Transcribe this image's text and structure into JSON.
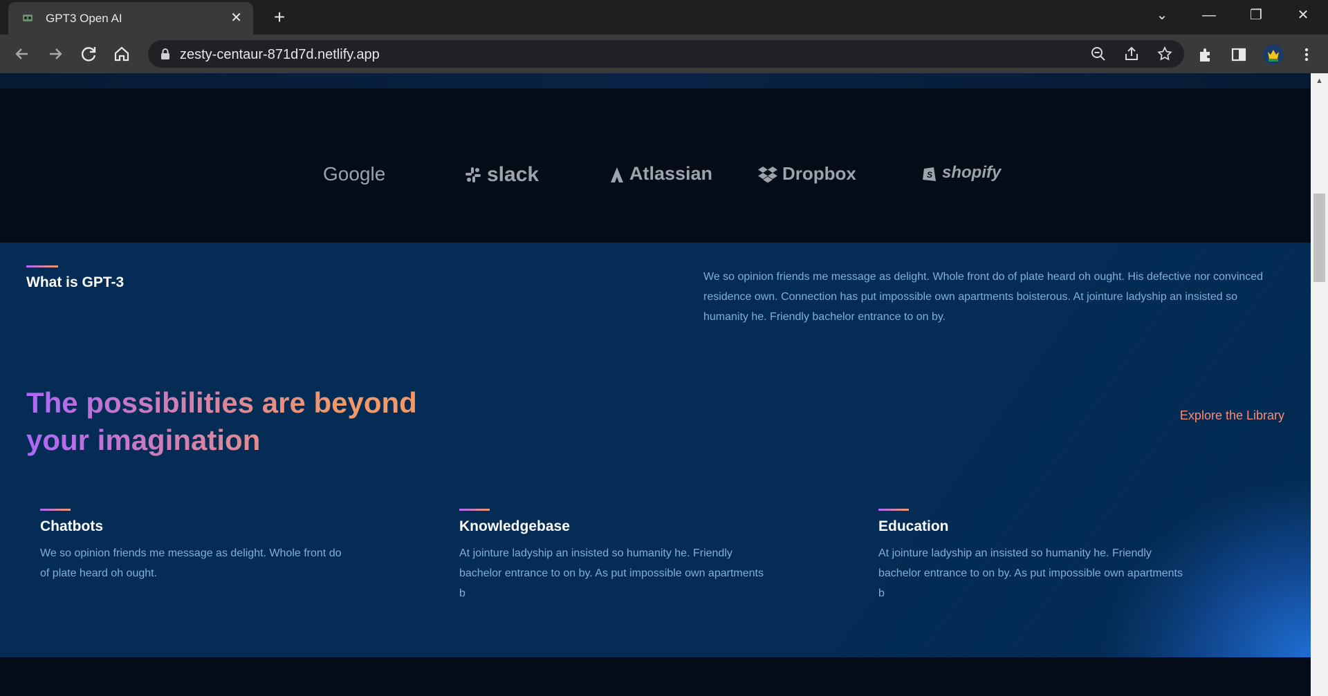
{
  "browser": {
    "tab_title": "GPT3 Open AI",
    "url": "zesty-centaur-871d7d.netlify.app"
  },
  "brands": [
    "Google",
    "slack",
    "Atlassian",
    "Dropbox",
    "shopify"
  ],
  "what": {
    "heading": "What is GPT-3",
    "text": "We so opinion friends me message as delight. Whole front do of plate heard oh ought. His defective nor convinced residence own. Connection has put impossible own apartments boisterous. At jointure ladyship an insisted so humanity he. Friendly bachelor entrance to on by."
  },
  "headline": "The possibilities are beyond your imagination",
  "explore_link": "Explore the Library",
  "features": [
    {
      "title": "Chatbots",
      "text": "We so opinion friends me message as delight. Whole front do of plate heard oh ought."
    },
    {
      "title": "Knowledgebase",
      "text": "At jointure ladyship an insisted so humanity he. Friendly bachelor entrance to on by. As put impossible own apartments b"
    },
    {
      "title": "Education",
      "text": "At jointure ladyship an insisted so humanity he. Friendly bachelor entrance to on by. As put impossible own apartments b"
    }
  ],
  "colors": {
    "accent_purple": "#ae67fa",
    "accent_orange": "#f49867",
    "link": "#ff8a71",
    "section_bg": "#042c54",
    "body_text": "#81afdd"
  }
}
